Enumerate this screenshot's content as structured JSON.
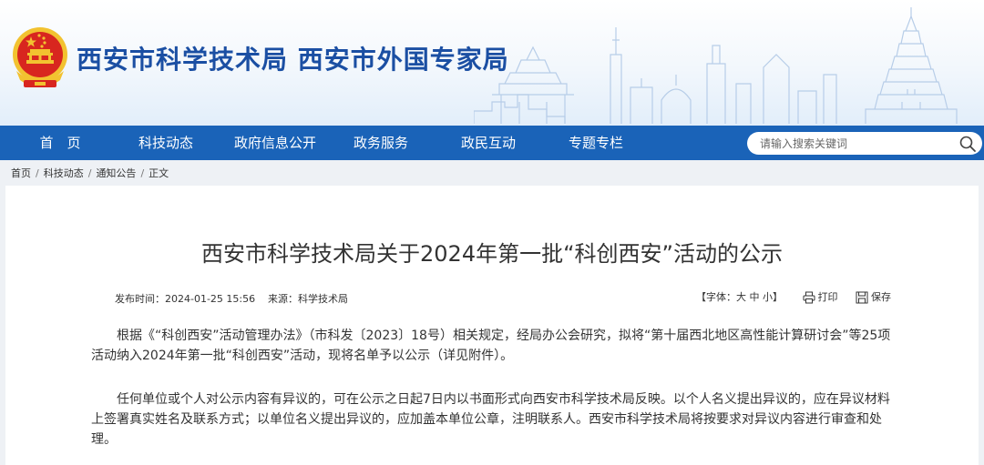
{
  "header": {
    "site_title": "西安市科学技术局 西安市外国专家局",
    "emblem_icon": "national-emblem-icon"
  },
  "nav": {
    "items": [
      "首　页",
      "科技动态",
      "政府信息公开",
      "政务服务",
      "政民互动",
      "专题专栏"
    ],
    "search_placeholder": "请输入搜索关键词",
    "search_icon": "search-icon"
  },
  "breadcrumb": [
    "首页",
    "科技动态",
    "通知公告",
    "正文"
  ],
  "breadcrumb_separator": "/",
  "article": {
    "title": "西安市科学技术局关于2024年第一批“科创西安”活动的公示",
    "publish_label": "发布时间：2024-01-25 15:56",
    "source_label": "来源：科学技术局",
    "font_size_label": "【字体：大 中 小】",
    "print_label": "打印",
    "save_label": "保存",
    "paragraphs": [
      "根据《“科创西安”活动管理办法》（市科发〔2023〕18号）相关规定，经局办公会研究，拟将“第十届西北地区高性能计算研讨会”等25项活动纳入2024年第一批“科创西安”活动，现将名单予以公示（详见附件）。",
      "任何单位或个人对公示内容有异议的，可在公示之日起7日内以书面形式向西安市科学技术局反映。以个人名义提出异议的，应在异议材料上签署真实姓名及联系方式；以单位名义提出异议的，应加盖本单位公章，注明联系人。西安市科学技术局将按要求对异议内容进行审查和处理。"
    ]
  },
  "colors": {
    "nav_bg": "#1a63b8",
    "title_blue": "#1b4fa3",
    "emblem_red": "#d8261f",
    "emblem_gold": "#f2c230"
  }
}
